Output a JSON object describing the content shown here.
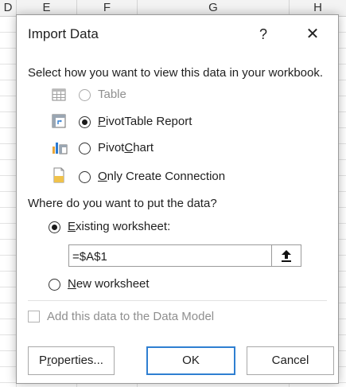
{
  "spreadsheet": {
    "columns": [
      "D",
      "E",
      "F",
      "G",
      "H"
    ]
  },
  "dialog": {
    "title": "Import Data",
    "help_label": "?",
    "close_label": "✕",
    "view_prompt": "Select how you want to view this data in your workbook.",
    "options": [
      {
        "label_pre": "",
        "label_u": "",
        "label_post": "Table",
        "checked": false,
        "enabled": false,
        "icon": "table-icon"
      },
      {
        "label_pre": "",
        "label_u": "P",
        "label_post": "ivotTable Report",
        "checked": true,
        "enabled": true,
        "icon": "pivottable-icon"
      },
      {
        "label_pre": "Pivot",
        "label_u": "C",
        "label_post": "hart",
        "checked": false,
        "enabled": true,
        "icon": "pivotchart-icon"
      },
      {
        "label_pre": "",
        "label_u": "O",
        "label_post": "nly Create Connection",
        "checked": false,
        "enabled": true,
        "icon": "connection-icon"
      }
    ],
    "location_prompt": "Where do you want to put the data?",
    "existing": {
      "label_u": "E",
      "label_post": "xisting worksheet:",
      "checked": true
    },
    "reference_value": "=$A$1",
    "new_sheet": {
      "label_u": "N",
      "label_post": "ew worksheet",
      "checked": false
    },
    "data_model_label": "Add this data to the Data Model",
    "buttons": {
      "properties_pre": "P",
      "properties_u": "r",
      "properties_post": "operties...",
      "ok": "OK",
      "cancel": "Cancel"
    }
  }
}
